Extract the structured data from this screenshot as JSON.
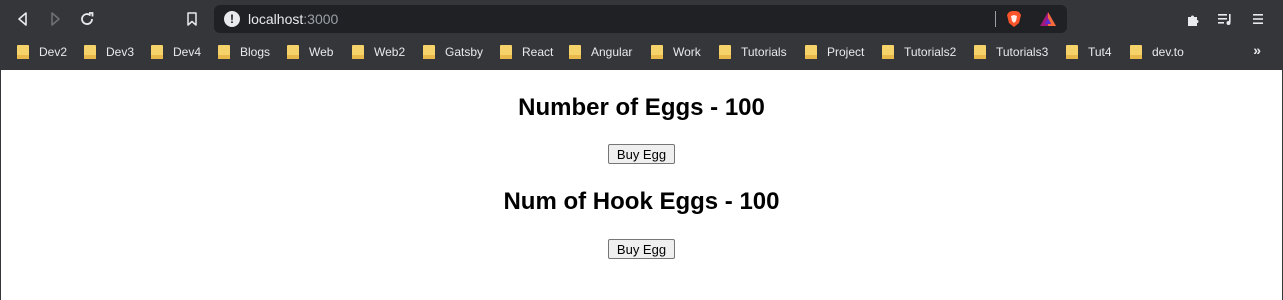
{
  "browser": {
    "url_host": "localhost",
    "url_port": ":3000",
    "icons": [
      "back-icon",
      "forward-icon",
      "reload-icon",
      "bookmark-icon",
      "info-icon",
      "brave-shield-icon",
      "brave-rewards-icon",
      "extensions-icon",
      "media-icon",
      "menu-icon"
    ],
    "bookmarks": [
      "Dev2",
      "Dev3",
      "Dev4",
      "Blogs",
      "Web",
      "Web2",
      "Gatsby",
      "React",
      "Angular",
      "Work",
      "Tutorials",
      "Project",
      "Tutorials2",
      "Tutorials3",
      "Tut4",
      "dev.to"
    ],
    "more_bookmarks": "»"
  },
  "page": {
    "heading1": "Number of Eggs - 100",
    "button1": "Buy Egg",
    "heading2": "Num of Hook Eggs - 100",
    "button2": "Buy Egg"
  }
}
